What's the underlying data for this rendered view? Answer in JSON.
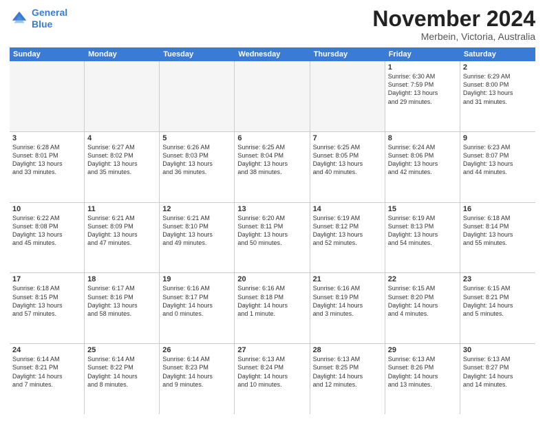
{
  "logo": {
    "line1": "General",
    "line2": "Blue"
  },
  "title": "November 2024",
  "location": "Merbein, Victoria, Australia",
  "header": {
    "days": [
      "Sunday",
      "Monday",
      "Tuesday",
      "Wednesday",
      "Thursday",
      "Friday",
      "Saturday"
    ]
  },
  "rows": [
    {
      "cells": [
        {
          "empty": true
        },
        {
          "empty": true
        },
        {
          "empty": true
        },
        {
          "empty": true
        },
        {
          "empty": true
        },
        {
          "day": "1",
          "info": "Sunrise: 6:30 AM\nSunset: 7:59 PM\nDaylight: 13 hours\nand 29 minutes."
        },
        {
          "day": "2",
          "info": "Sunrise: 6:29 AM\nSunset: 8:00 PM\nDaylight: 13 hours\nand 31 minutes."
        }
      ]
    },
    {
      "cells": [
        {
          "day": "3",
          "info": "Sunrise: 6:28 AM\nSunset: 8:01 PM\nDaylight: 13 hours\nand 33 minutes."
        },
        {
          "day": "4",
          "info": "Sunrise: 6:27 AM\nSunset: 8:02 PM\nDaylight: 13 hours\nand 35 minutes."
        },
        {
          "day": "5",
          "info": "Sunrise: 6:26 AM\nSunset: 8:03 PM\nDaylight: 13 hours\nand 36 minutes."
        },
        {
          "day": "6",
          "info": "Sunrise: 6:25 AM\nSunset: 8:04 PM\nDaylight: 13 hours\nand 38 minutes."
        },
        {
          "day": "7",
          "info": "Sunrise: 6:25 AM\nSunset: 8:05 PM\nDaylight: 13 hours\nand 40 minutes."
        },
        {
          "day": "8",
          "info": "Sunrise: 6:24 AM\nSunset: 8:06 PM\nDaylight: 13 hours\nand 42 minutes."
        },
        {
          "day": "9",
          "info": "Sunrise: 6:23 AM\nSunset: 8:07 PM\nDaylight: 13 hours\nand 44 minutes."
        }
      ]
    },
    {
      "cells": [
        {
          "day": "10",
          "info": "Sunrise: 6:22 AM\nSunset: 8:08 PM\nDaylight: 13 hours\nand 45 minutes."
        },
        {
          "day": "11",
          "info": "Sunrise: 6:21 AM\nSunset: 8:09 PM\nDaylight: 13 hours\nand 47 minutes."
        },
        {
          "day": "12",
          "info": "Sunrise: 6:21 AM\nSunset: 8:10 PM\nDaylight: 13 hours\nand 49 minutes."
        },
        {
          "day": "13",
          "info": "Sunrise: 6:20 AM\nSunset: 8:11 PM\nDaylight: 13 hours\nand 50 minutes."
        },
        {
          "day": "14",
          "info": "Sunrise: 6:19 AM\nSunset: 8:12 PM\nDaylight: 13 hours\nand 52 minutes."
        },
        {
          "day": "15",
          "info": "Sunrise: 6:19 AM\nSunset: 8:13 PM\nDaylight: 13 hours\nand 54 minutes."
        },
        {
          "day": "16",
          "info": "Sunrise: 6:18 AM\nSunset: 8:14 PM\nDaylight: 13 hours\nand 55 minutes."
        }
      ]
    },
    {
      "cells": [
        {
          "day": "17",
          "info": "Sunrise: 6:18 AM\nSunset: 8:15 PM\nDaylight: 13 hours\nand 57 minutes."
        },
        {
          "day": "18",
          "info": "Sunrise: 6:17 AM\nSunset: 8:16 PM\nDaylight: 13 hours\nand 58 minutes."
        },
        {
          "day": "19",
          "info": "Sunrise: 6:16 AM\nSunset: 8:17 PM\nDaylight: 14 hours\nand 0 minutes."
        },
        {
          "day": "20",
          "info": "Sunrise: 6:16 AM\nSunset: 8:18 PM\nDaylight: 14 hours\nand 1 minute."
        },
        {
          "day": "21",
          "info": "Sunrise: 6:16 AM\nSunset: 8:19 PM\nDaylight: 14 hours\nand 3 minutes."
        },
        {
          "day": "22",
          "info": "Sunrise: 6:15 AM\nSunset: 8:20 PM\nDaylight: 14 hours\nand 4 minutes."
        },
        {
          "day": "23",
          "info": "Sunrise: 6:15 AM\nSunset: 8:21 PM\nDaylight: 14 hours\nand 5 minutes."
        }
      ]
    },
    {
      "cells": [
        {
          "day": "24",
          "info": "Sunrise: 6:14 AM\nSunset: 8:21 PM\nDaylight: 14 hours\nand 7 minutes."
        },
        {
          "day": "25",
          "info": "Sunrise: 6:14 AM\nSunset: 8:22 PM\nDaylight: 14 hours\nand 8 minutes."
        },
        {
          "day": "26",
          "info": "Sunrise: 6:14 AM\nSunset: 8:23 PM\nDaylight: 14 hours\nand 9 minutes."
        },
        {
          "day": "27",
          "info": "Sunrise: 6:13 AM\nSunset: 8:24 PM\nDaylight: 14 hours\nand 10 minutes."
        },
        {
          "day": "28",
          "info": "Sunrise: 6:13 AM\nSunset: 8:25 PM\nDaylight: 14 hours\nand 12 minutes."
        },
        {
          "day": "29",
          "info": "Sunrise: 6:13 AM\nSunset: 8:26 PM\nDaylight: 14 hours\nand 13 minutes."
        },
        {
          "day": "30",
          "info": "Sunrise: 6:13 AM\nSunset: 8:27 PM\nDaylight: 14 hours\nand 14 minutes."
        }
      ]
    }
  ]
}
